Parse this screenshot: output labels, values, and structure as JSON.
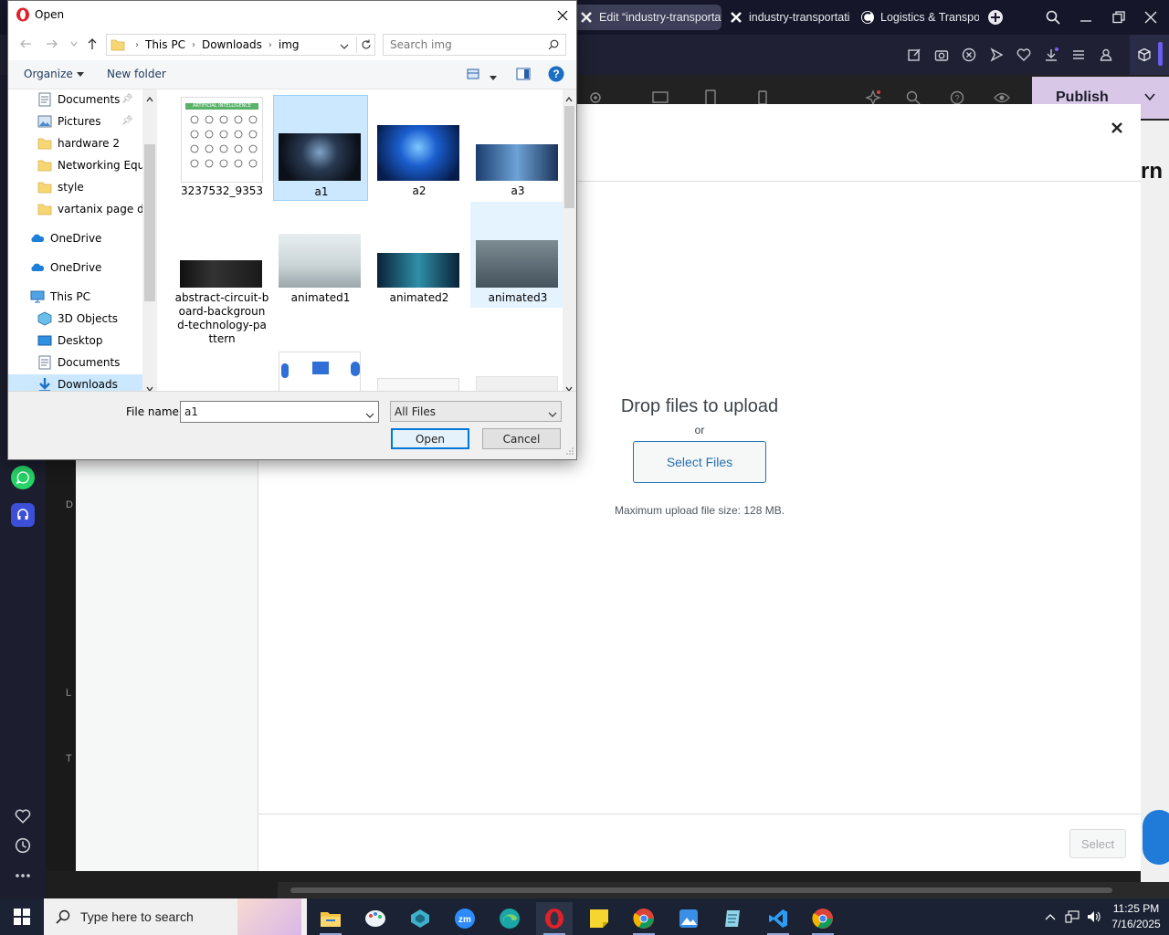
{
  "browser": {
    "tabs": [
      {
        "label": "Edit “industry-transportati",
        "active": true
      },
      {
        "label": "industry-transportati",
        "active": false
      },
      {
        "label": "Logistics & Transpor",
        "active": false
      }
    ]
  },
  "wordpress": {
    "publish_label": "Publish",
    "side_letters": [
      "D",
      "L",
      "T"
    ]
  },
  "media_modal": {
    "drop_title": "Drop files to upload",
    "or_text": "or",
    "select_files_label": "Select Files",
    "max_size_text": "Maximum upload file size: 128 MB.",
    "select_button_label": "Select"
  },
  "dialog": {
    "title": "Open",
    "breadcrumb": [
      "This PC",
      "Downloads",
      "img"
    ],
    "search_placeholder": "Search img",
    "organize_label": "Organize",
    "new_folder_label": "New folder",
    "nav_items": [
      {
        "label": "Documents",
        "icon": "documents-icon",
        "pinned": true
      },
      {
        "label": "Pictures",
        "icon": "pictures-icon",
        "pinned": true
      },
      {
        "label": "hardware 2",
        "icon": "folder-icon",
        "pinned": false
      },
      {
        "label": "Networking Equ",
        "icon": "folder-icon",
        "pinned": false
      },
      {
        "label": "style",
        "icon": "folder-icon",
        "pinned": false
      },
      {
        "label": "vartanix page de",
        "icon": "folder-icon",
        "pinned": false
      },
      {
        "label": "OneDrive",
        "icon": "onedrive-icon",
        "pinned": false
      },
      {
        "label": "OneDrive",
        "icon": "onedrive-icon",
        "pinned": false
      },
      {
        "label": "This PC",
        "icon": "this-pc-icon",
        "pinned": false
      },
      {
        "label": "3D Objects",
        "icon": "3d-objects-icon",
        "pinned": false
      },
      {
        "label": "Desktop",
        "icon": "desktop-icon",
        "pinned": false
      },
      {
        "label": "Documents",
        "icon": "documents-icon",
        "pinned": false
      },
      {
        "label": "Downloads",
        "icon": "downloads-icon",
        "pinned": false
      }
    ],
    "files": [
      {
        "name": "3237532_9353",
        "state": "normal"
      },
      {
        "name": "a1",
        "state": "selected"
      },
      {
        "name": "a2",
        "state": "normal"
      },
      {
        "name": "a3",
        "state": "normal"
      },
      {
        "name": "abstract-circuit-board-background-technology-pattern",
        "name_lines": [
          "abstract-circuit-b",
          "oard-backgroun",
          "d-technology-pa",
          "ttern"
        ],
        "state": "normal"
      },
      {
        "name": "animated1",
        "state": "normal"
      },
      {
        "name": "animated2",
        "state": "normal"
      },
      {
        "name": "animated3",
        "state": "hover"
      }
    ],
    "infographic_title": "ARTIFICIAL INTELLIGENCE",
    "file_name_label": "File name:",
    "file_name_value": "a1",
    "file_type_value": "All Files",
    "open_label": "Open",
    "cancel_label": "Cancel"
  },
  "taskbar": {
    "search_placeholder": "Type here to search",
    "time": "11:25 PM",
    "date": "7/16/2025",
    "apps": [
      "file-explorer",
      "paint",
      "app",
      "zoom",
      "edge",
      "opera",
      "sticky-notes",
      "chrome",
      "photos",
      "notepad",
      "vscode",
      "chrome"
    ]
  },
  "colors": {
    "accent_blue": "#2271b1",
    "selection": "#cce8ff",
    "publish_bg": "#d9c7e8"
  }
}
